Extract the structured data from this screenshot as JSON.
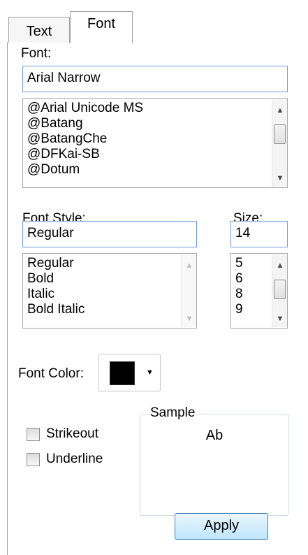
{
  "tabs": [
    {
      "label": "Text",
      "active": false
    },
    {
      "label": "Font",
      "active": true
    }
  ],
  "font": {
    "label": "Font:",
    "value": "Arial Narrow",
    "list": [
      "@Arial Unicode MS",
      "@Batang",
      "@BatangChe",
      "@DFKai-SB",
      "@Dotum"
    ]
  },
  "font_style": {
    "label": "Font Style:",
    "value": "Regular",
    "list": [
      "Regular",
      "Bold",
      "Italic",
      "Bold Italic"
    ]
  },
  "size": {
    "label": "Size:",
    "value": "14",
    "list": [
      "5",
      "6",
      "8",
      "9"
    ]
  },
  "font_color": {
    "label": "Font Color:",
    "swatch": "#000000"
  },
  "checkboxes": {
    "strikeout": {
      "label": "Strikeout",
      "checked": false
    },
    "underline": {
      "label": "Underline",
      "checked": false
    }
  },
  "sample": {
    "title": "Sample",
    "text": "Ab"
  },
  "apply_label": "Apply",
  "icons": {
    "scroll_up": "scroll-up-arrow-icon",
    "scroll_down": "scroll-down-arrow-icon",
    "dropdown": "dropdown-arrow-icon"
  }
}
